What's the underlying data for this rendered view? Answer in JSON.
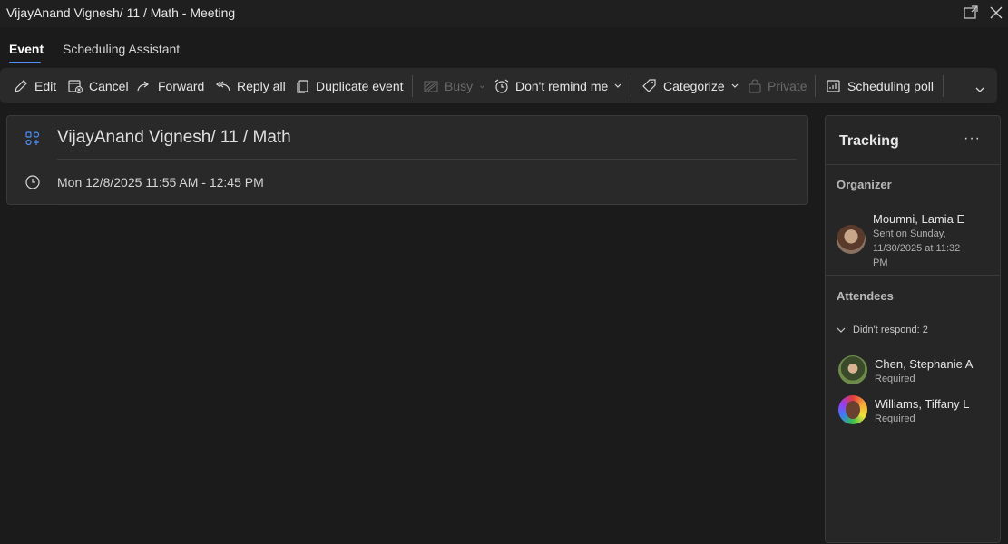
{
  "window": {
    "title": "VijayAnand Vignesh/ 11 / Math - Meeting"
  },
  "tabs": [
    {
      "label": "Event",
      "active": true
    },
    {
      "label": "Scheduling Assistant",
      "active": false
    }
  ],
  "toolbar": {
    "edit": "Edit",
    "cancel": "Cancel",
    "forward": "Forward",
    "reply_all": "Reply all",
    "duplicate": "Duplicate event",
    "busy": "Busy",
    "remind": "Don't remind me",
    "categorize": "Categorize",
    "private": "Private",
    "scheduling_poll": "Scheduling poll"
  },
  "event": {
    "subject": "VijayAnand Vignesh/ 11 / Math",
    "datetime": "Mon 12/8/2025 11:55 AM - 12:45 PM"
  },
  "tracking": {
    "title": "Tracking",
    "more": "···",
    "organizer_label": "Organizer",
    "organizer": {
      "name": "Moumni, Lamia E",
      "sent_line1": "Sent on Sunday,",
      "sent_line2": "11/30/2025 at 11:32",
      "sent_line3": "PM"
    },
    "attendees_label": "Attendees",
    "group_label": "Didn't respond: 2",
    "attendees": [
      {
        "name": "Chen, Stephanie A",
        "role": "Required"
      },
      {
        "name": "Williams, Tiffany L",
        "role": "Required"
      }
    ]
  },
  "colors": {
    "accent": "#4f8ef7",
    "background": "#1b1b1b",
    "toolbar": "#2a2a2a"
  }
}
